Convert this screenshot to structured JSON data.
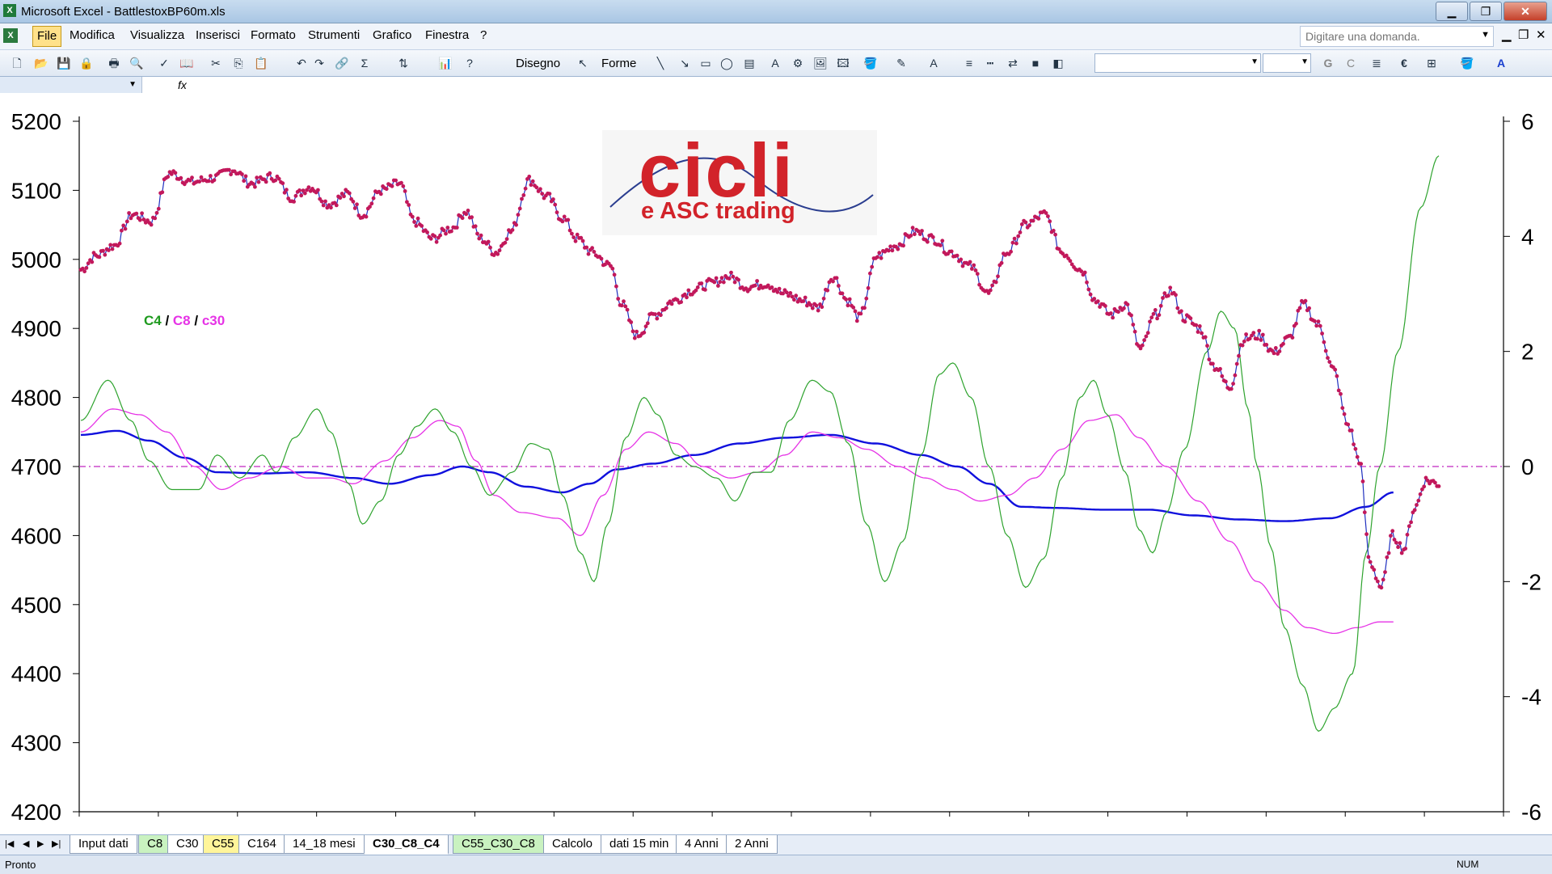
{
  "window": {
    "title": "Microsoft Excel - BattlestoxBP60m.xls",
    "controls": [
      "▁",
      "❐",
      "✕"
    ]
  },
  "menu": {
    "items": [
      "File",
      "Modifica",
      "Visualizza",
      "Inserisci",
      "Formato",
      "Strumenti",
      "Grafico",
      "Finestra",
      "?"
    ],
    "ask_placeholder": "Digitare una domanda."
  },
  "toolbar": {
    "draw_label": "Disegno",
    "shapes_label": "Forme",
    "bold": "G",
    "italic": "C",
    "euro": "€"
  },
  "formula_bar": {
    "fx": "fx"
  },
  "chart": {
    "logo_main": "cicli",
    "logo_sub": "e ASC trading",
    "legend": {
      "c4": "C4",
      "sep": " / ",
      "c8": "C8",
      "sep2": " / ",
      "c30": "c30"
    },
    "colors": {
      "price": "#1f2fbf",
      "price_marker": "#c2185b",
      "c4": "#2ea32e",
      "c8": "#e633e6",
      "c30": "#1010dd",
      "zero_line": "#c026c0"
    }
  },
  "chart_data": {
    "type": "line",
    "y_left": {
      "ticks": [
        "5200",
        "5100",
        "5000",
        "4900",
        "4800",
        "4700",
        "4600",
        "4500",
        "4400",
        "4300",
        "4200"
      ],
      "range": [
        4200,
        5200
      ]
    },
    "y_right": {
      "ticks": [
        "6",
        "4",
        "2",
        "0",
        "-2",
        "-4",
        "-6"
      ],
      "range": [
        -6,
        6
      ]
    },
    "price": {
      "axis": "left",
      "knots": [
        [
          0,
          4985
        ],
        [
          8,
          5005
        ],
        [
          18,
          5020
        ],
        [
          28,
          5065
        ],
        [
          38,
          5055
        ],
        [
          48,
          5125
        ],
        [
          60,
          5112
        ],
        [
          72,
          5118
        ],
        [
          82,
          5130
        ],
        [
          92,
          5110
        ],
        [
          104,
          5120
        ],
        [
          114,
          5090
        ],
        [
          124,
          5105
        ],
        [
          134,
          5080
        ],
        [
          144,
          5095
        ],
        [
          152,
          5065
        ],
        [
          162,
          5100
        ],
        [
          172,
          5110
        ],
        [
          180,
          5055
        ],
        [
          190,
          5030
        ],
        [
          200,
          5045
        ],
        [
          208,
          5070
        ],
        [
          216,
          5030
        ],
        [
          224,
          5010
        ],
        [
          232,
          5040
        ],
        [
          242,
          5115
        ],
        [
          252,
          5090
        ],
        [
          260,
          5060
        ],
        [
          268,
          5030
        ],
        [
          276,
          5010
        ],
        [
          286,
          4990
        ],
        [
          292,
          4935
        ],
        [
          300,
          4890
        ],
        [
          310,
          4920
        ],
        [
          320,
          4940
        ],
        [
          330,
          4955
        ],
        [
          340,
          4965
        ],
        [
          350,
          4975
        ],
        [
          360,
          4960
        ],
        [
          370,
          4965
        ],
        [
          380,
          4950
        ],
        [
          390,
          4940
        ],
        [
          398,
          4930
        ],
        [
          406,
          4975
        ],
        [
          414,
          4940
        ],
        [
          420,
          4915
        ],
        [
          430,
          5005
        ],
        [
          440,
          5020
        ],
        [
          450,
          5040
        ],
        [
          460,
          5030
        ],
        [
          470,
          5010
        ],
        [
          480,
          4990
        ],
        [
          490,
          4950
        ],
        [
          500,
          5010
        ],
        [
          510,
          5050
        ],
        [
          520,
          5065
        ],
        [
          530,
          5010
        ],
        [
          540,
          4985
        ],
        [
          548,
          4940
        ],
        [
          556,
          4920
        ],
        [
          564,
          4935
        ],
        [
          572,
          4870
        ],
        [
          580,
          4920
        ],
        [
          588,
          4955
        ],
        [
          596,
          4915
        ],
        [
          604,
          4900
        ],
        [
          612,
          4845
        ],
        [
          620,
          4815
        ],
        [
          628,
          4885
        ],
        [
          636,
          4890
        ],
        [
          644,
          4865
        ],
        [
          652,
          4885
        ],
        [
          660,
          4935
        ],
        [
          668,
          4905
        ],
        [
          676,
          4840
        ],
        [
          684,
          4760
        ],
        [
          690,
          4710
        ],
        [
          696,
          4560
        ],
        [
          702,
          4525
        ],
        [
          708,
          4600
        ],
        [
          714,
          4580
        ],
        [
          720,
          4640
        ],
        [
          726,
          4680
        ],
        [
          733,
          4675
        ]
      ]
    },
    "c4": {
      "axis": "right",
      "knots": [
        [
          0,
          0.8
        ],
        [
          12,
          1.5
        ],
        [
          22,
          0.8
        ],
        [
          30,
          0.1
        ],
        [
          40,
          -0.4
        ],
        [
          52,
          -0.4
        ],
        [
          60,
          0.2
        ],
        [
          70,
          -0.2
        ],
        [
          80,
          0.2
        ],
        [
          86,
          -0.1
        ],
        [
          94,
          0.5
        ],
        [
          104,
          1.0
        ],
        [
          110,
          0.6
        ],
        [
          118,
          -0.3
        ],
        [
          124,
          -1.0
        ],
        [
          132,
          -0.6
        ],
        [
          140,
          0.2
        ],
        [
          148,
          0.7
        ],
        [
          156,
          1.0
        ],
        [
          164,
          0.6
        ],
        [
          172,
          0.0
        ],
        [
          180,
          -0.5
        ],
        [
          190,
          -0.1
        ],
        [
          198,
          0.4
        ],
        [
          206,
          0.3
        ],
        [
          212,
          -0.5
        ],
        [
          220,
          -1.5
        ],
        [
          226,
          -2.0
        ],
        [
          232,
          -1.0
        ],
        [
          240,
          0.5
        ],
        [
          248,
          1.2
        ],
        [
          254,
          0.9
        ],
        [
          262,
          0.2
        ],
        [
          270,
          0.0
        ],
        [
          280,
          -0.2
        ],
        [
          288,
          -0.6
        ],
        [
          296,
          -0.1
        ],
        [
          304,
          -0.1
        ],
        [
          312,
          0.8
        ],
        [
          322,
          1.5
        ],
        [
          330,
          1.3
        ],
        [
          338,
          0.4
        ],
        [
          346,
          -1.0
        ],
        [
          354,
          -2.0
        ],
        [
          362,
          -1.3
        ],
        [
          370,
          0.2
        ],
        [
          378,
          1.6
        ],
        [
          384,
          1.8
        ],
        [
          392,
          1.2
        ],
        [
          400,
          0.0
        ],
        [
          408,
          -1.2
        ],
        [
          416,
          -2.1
        ],
        [
          424,
          -1.6
        ],
        [
          432,
          -0.2
        ],
        [
          440,
          1.2
        ],
        [
          446,
          1.5
        ],
        [
          452,
          0.9
        ],
        [
          460,
          -0.1
        ],
        [
          466,
          -1.1
        ],
        [
          472,
          -1.5
        ],
        [
          478,
          -0.8
        ],
        [
          486,
          0.3
        ],
        [
          496,
          2.0
        ],
        [
          502,
          2.7
        ],
        [
          508,
          2.4
        ],
        [
          514,
          1.0
        ],
        [
          518,
          0.0
        ],
        [
          524,
          -1.4
        ],
        [
          530,
          -2.8
        ],
        [
          538,
          -3.8
        ],
        [
          545,
          -4.6
        ],
        [
          552,
          -4.2
        ],
        [
          560,
          -3.6
        ],
        [
          566,
          -1.5
        ],
        [
          572,
          0.0
        ],
        [
          580,
          2.0
        ],
        [
          590,
          4.5
        ],
        [
          598,
          5.4
        ]
      ]
    },
    "c8": {
      "axis": "right",
      "knots": [
        [
          0,
          0.6
        ],
        [
          14,
          1.0
        ],
        [
          26,
          0.9
        ],
        [
          38,
          0.6
        ],
        [
          50,
          0.0
        ],
        [
          62,
          -0.4
        ],
        [
          74,
          -0.2
        ],
        [
          88,
          0.0
        ],
        [
          100,
          -0.2
        ],
        [
          110,
          -0.2
        ],
        [
          120,
          -0.3
        ],
        [
          134,
          0.1
        ],
        [
          146,
          0.5
        ],
        [
          158,
          0.8
        ],
        [
          166,
          0.7
        ],
        [
          174,
          0.1
        ],
        [
          182,
          -0.5
        ],
        [
          194,
          -0.8
        ],
        [
          210,
          -0.9
        ],
        [
          220,
          -1.2
        ],
        [
          230,
          -0.5
        ],
        [
          240,
          0.3
        ],
        [
          250,
          0.6
        ],
        [
          262,
          0.4
        ],
        [
          274,
          0.0
        ],
        [
          286,
          -0.2
        ],
        [
          298,
          -0.1
        ],
        [
          310,
          0.2
        ],
        [
          322,
          0.6
        ],
        [
          334,
          0.5
        ],
        [
          346,
          0.3
        ],
        [
          360,
          0.0
        ],
        [
          372,
          -0.2
        ],
        [
          384,
          -0.4
        ],
        [
          396,
          -0.6
        ],
        [
          408,
          -0.5
        ],
        [
          420,
          -0.2
        ],
        [
          432,
          0.3
        ],
        [
          444,
          0.8
        ],
        [
          456,
          0.9
        ],
        [
          466,
          0.5
        ],
        [
          478,
          0.0
        ],
        [
          492,
          -0.6
        ],
        [
          506,
          -1.3
        ],
        [
          518,
          -2.0
        ],
        [
          530,
          -2.5
        ],
        [
          540,
          -2.8
        ],
        [
          552,
          -2.9
        ],
        [
          562,
          -2.8
        ],
        [
          572,
          -2.7
        ],
        [
          578,
          -2.7
        ]
      ]
    },
    "c30": {
      "axis": "right",
      "knots": [
        [
          0,
          0.55
        ],
        [
          16,
          0.62
        ],
        [
          30,
          0.45
        ],
        [
          46,
          0.15
        ],
        [
          60,
          -0.1
        ],
        [
          80,
          -0.12
        ],
        [
          100,
          -0.1
        ],
        [
          120,
          -0.2
        ],
        [
          136,
          -0.3
        ],
        [
          154,
          -0.15
        ],
        [
          168,
          0.0
        ],
        [
          180,
          -0.1
        ],
        [
          196,
          -0.35
        ],
        [
          212,
          -0.45
        ],
        [
          224,
          -0.3
        ],
        [
          236,
          -0.05
        ],
        [
          252,
          0.05
        ],
        [
          270,
          0.2
        ],
        [
          290,
          0.4
        ],
        [
          310,
          0.5
        ],
        [
          330,
          0.55
        ],
        [
          350,
          0.4
        ],
        [
          370,
          0.2
        ],
        [
          386,
          0.0
        ],
        [
          400,
          -0.3
        ],
        [
          414,
          -0.7
        ],
        [
          430,
          -0.72
        ],
        [
          450,
          -0.75
        ],
        [
          470,
          -0.75
        ],
        [
          490,
          -0.85
        ],
        [
          510,
          -0.92
        ],
        [
          530,
          -0.95
        ],
        [
          550,
          -0.9
        ],
        [
          566,
          -0.7
        ],
        [
          578,
          -0.45
        ]
      ]
    }
  },
  "sheets": {
    "tabs": [
      "Input dati",
      "C8",
      "C30",
      "C55",
      "C164",
      "14_18 mesi",
      "C30_C8_C4",
      "C55_C30_C8",
      "Calcolo",
      "dati 15 min",
      "4 Anni",
      "2 Anni"
    ],
    "active": "C30_C8_C4"
  },
  "status": {
    "text": "Pronto",
    "num": "NUM"
  }
}
